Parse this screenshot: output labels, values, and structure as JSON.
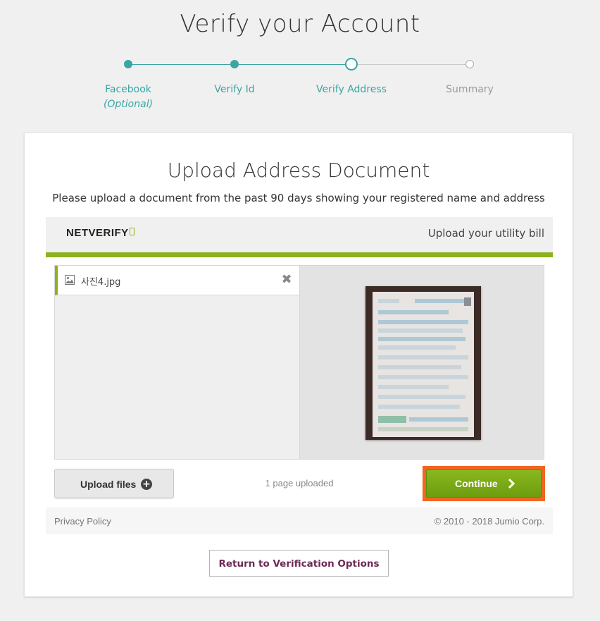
{
  "header": {
    "title": "Verify your Account"
  },
  "stepper": {
    "steps": [
      {
        "label": "Facebook",
        "sub": "(Optional)",
        "state": "done"
      },
      {
        "label": "Verify Id",
        "state": "done"
      },
      {
        "label": "Verify Address",
        "state": "current"
      },
      {
        "label": "Summary",
        "state": "future"
      }
    ]
  },
  "card": {
    "title": "Upload Address Document",
    "subtitle": "Please upload a document from the past 90 days showing your registered name and address"
  },
  "netverify": {
    "logo_text": "NETVERIFY",
    "header_right": "Upload your utility bill",
    "files": [
      {
        "name": "사진4.jpg"
      }
    ],
    "upload_label": "Upload files",
    "pages_uploaded": "1 page uploaded",
    "continue_label": "Continue",
    "privacy": "Privacy Policy",
    "copyright": "© 2010 - 2018 Jumio Corp."
  },
  "return_button": "Return to Verification Options",
  "colors": {
    "teal": "#3aa5a3",
    "green": "#8cb21d",
    "highlight": "#f26522",
    "return_text": "#6d2a55"
  },
  "icons": {
    "file": "image-file-icon",
    "remove": "close-icon",
    "upload": "plus-circle-icon",
    "continue": "chevron-right-icon"
  }
}
